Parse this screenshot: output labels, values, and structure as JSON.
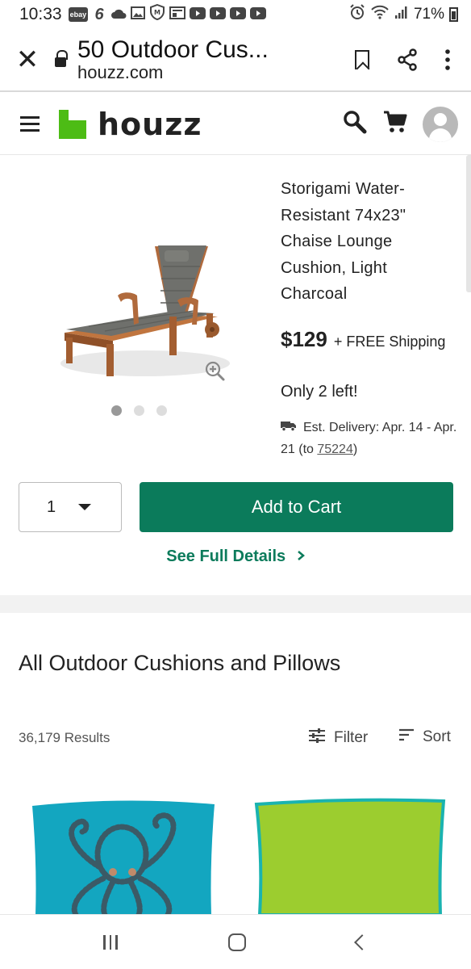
{
  "status_bar": {
    "time": "10:33",
    "notification_icons": [
      "ebay-icon",
      "six-icon",
      "cloud-icon",
      "gallery-icon",
      "m-shield-icon",
      "news-icon",
      "youtube-icon",
      "youtube-icon",
      "youtube-icon",
      "youtube-icon"
    ],
    "ebay_label": "ebay",
    "six_label": "6",
    "battery": "71%"
  },
  "browser": {
    "page_title": "50 Outdoor Cus...",
    "domain": "houzz.com"
  },
  "site_header": {
    "logo_text": "houzz",
    "brand_color": "#4dbc15"
  },
  "product": {
    "title": "Storigami Water-Resistant 74x23\" Chaise Lounge Cushion, Light Charcoal",
    "price": "$129",
    "shipping": "+ FREE Shipping",
    "stock": "Only 2 left!",
    "delivery_prefix": "Est. Delivery: Apr. 14 - Apr. 21 (to ",
    "delivery_zip": "75224",
    "delivery_suffix": ")",
    "image_count": 3,
    "active_image": 1
  },
  "purchase": {
    "quantity": "1",
    "add_to_cart_label": "Add to Cart",
    "see_details_label": "See Full Details",
    "accent_color": "#0b7b5b"
  },
  "listing": {
    "heading": "All Outdoor Cushions and Pillows",
    "results": "36,179 Results",
    "filter_label": "Filter",
    "sort_label": "Sort"
  }
}
